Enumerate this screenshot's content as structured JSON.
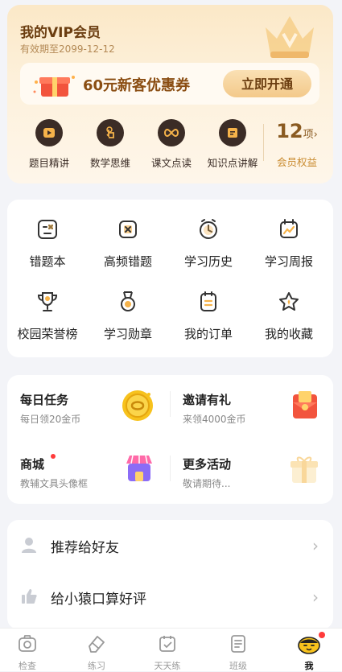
{
  "vip": {
    "title": "我的VIP会员",
    "expire": "有效期至2099-12-12",
    "coupon_text": "60元新客优惠券",
    "coupon_button": "立即开通",
    "items": [
      {
        "label": "题目精讲",
        "icon": "play-icon"
      },
      {
        "label": "数学思维",
        "icon": "tap-hand-icon"
      },
      {
        "label": "课文点读",
        "icon": "infinity-icon"
      },
      {
        "label": "知识点讲解",
        "icon": "card-icon"
      }
    ],
    "benefit_count": "12",
    "benefit_unit": "项",
    "benefit_arrow": "›",
    "benefit_label": "会员权益",
    "accent_color": "#c98a2e"
  },
  "grid": {
    "items": [
      {
        "label": "错题本",
        "icon": "wrong-question-icon"
      },
      {
        "label": "高频错题",
        "icon": "frequent-error-icon"
      },
      {
        "label": "学习历史",
        "icon": "clock-icon"
      },
      {
        "label": "学习周报",
        "icon": "weekly-report-icon"
      },
      {
        "label": "校园荣誉榜",
        "icon": "trophy-icon"
      },
      {
        "label": "学习勋章",
        "icon": "medal-icon"
      },
      {
        "label": "我的订单",
        "icon": "order-icon"
      },
      {
        "label": "我的收藏",
        "icon": "star-icon"
      }
    ]
  },
  "tasks": {
    "items": [
      {
        "title": "每日任务",
        "subtitle": "每日领20金币",
        "icon": "gold-coin-icon"
      },
      {
        "title": "邀请有礼",
        "subtitle": "来领4000金币",
        "icon": "red-envelope-icon"
      },
      {
        "title": "商城",
        "subtitle": "教辅文具头像框",
        "icon": "shop-icon"
      },
      {
        "title": "更多活动",
        "subtitle": "敬请期待...",
        "icon": "gift-icon"
      }
    ]
  },
  "list": {
    "items": [
      {
        "label": "推荐给好友",
        "icon": "person-icon"
      },
      {
        "label": "给小猿口算好评",
        "icon": "thumbs-up-icon"
      }
    ],
    "arrow": "›"
  },
  "tabbar": {
    "tabs": [
      {
        "label": "检查",
        "icon": "camera-icon"
      },
      {
        "label": "练习",
        "icon": "eraser-icon"
      },
      {
        "label": "天天练",
        "icon": "checkbox-icon"
      },
      {
        "label": "班级",
        "icon": "class-icon"
      },
      {
        "label": "我",
        "icon": "mascot-icon"
      }
    ],
    "active_index": 4
  }
}
